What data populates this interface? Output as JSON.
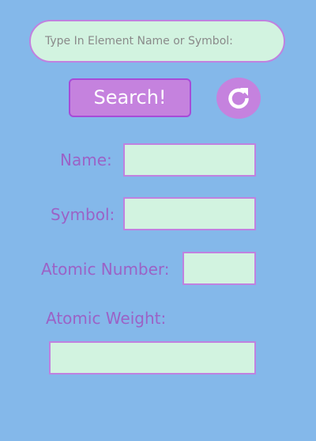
{
  "search": {
    "placeholder": "Type In Element Name or Symbol:",
    "value": ""
  },
  "buttons": {
    "search_label": "Search!",
    "refresh_icon": "refresh-icon"
  },
  "fields": {
    "name": {
      "label": "Name:",
      "value": ""
    },
    "symbol": {
      "label": "Symbol:",
      "value": ""
    },
    "atomic_number": {
      "label": "Atomic Number:",
      "value": ""
    },
    "atomic_weight": {
      "label": "Atomic Weight:",
      "value": ""
    }
  },
  "colors": {
    "background": "#84b8ea",
    "field_fill": "#d2f3e0",
    "accent_purple": "#c582de",
    "border_purple": "#c081e0",
    "label_purple": "#9b62c6"
  }
}
